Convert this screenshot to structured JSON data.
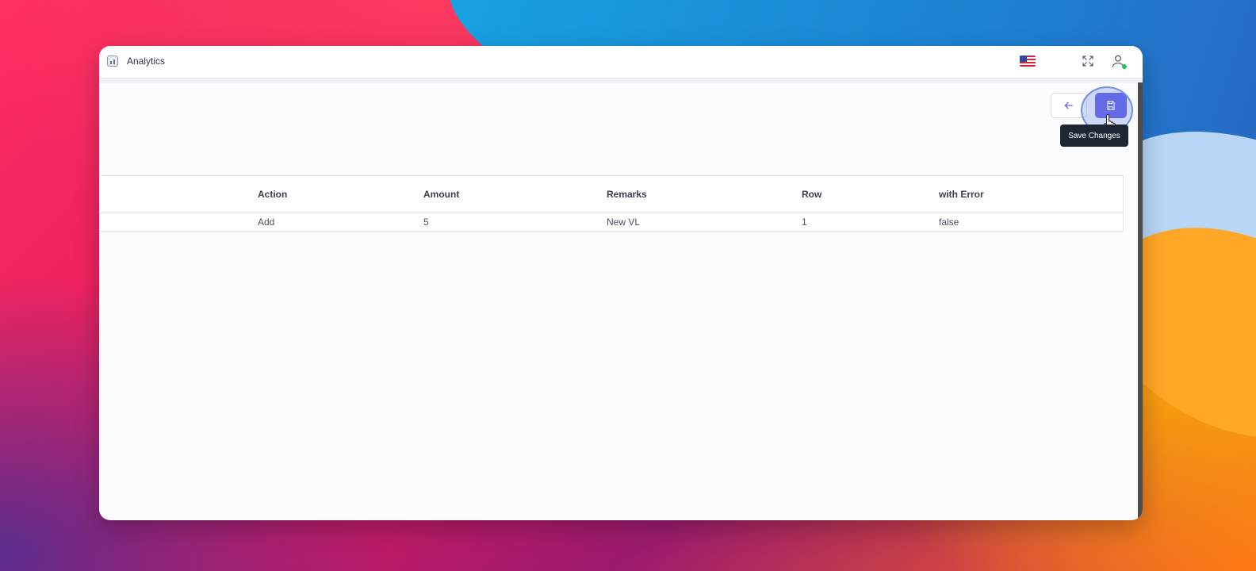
{
  "window": {
    "title": "Analytics"
  },
  "titlebar_icons": [
    "us-flag-icon",
    "moon-icon",
    "fullscreen-icon",
    "user-icon"
  ],
  "toolbar": {
    "back_icon": "arrow-left-icon",
    "save_icon": "floppy-disk-icon",
    "tooltip": "Save Changes"
  },
  "table": {
    "headers": [
      "",
      "Action",
      "Amount",
      "Remarks",
      "Row",
      "with Error"
    ],
    "rows": [
      [
        "",
        "Add",
        "5",
        "New VL",
        "1",
        "false"
      ]
    ]
  },
  "colors": {
    "primary": "#5a55e0",
    "online_status": "#22c55e"
  }
}
